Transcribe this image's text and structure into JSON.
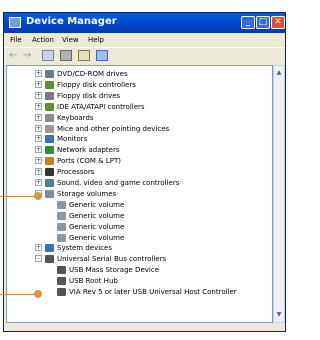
{
  "window": {
    "title": "Device Manager",
    "buttons": {
      "minimize": "_",
      "maximize": "□",
      "close": "✕"
    }
  },
  "menu": [
    "File",
    "Action",
    "View",
    "Help"
  ],
  "toolbar": [
    "back-icon",
    "forward-icon",
    "properties-icon",
    "print-icon",
    "help-icon",
    "scan-icon"
  ],
  "tree": [
    {
      "label": "DVD/CD-ROM drives",
      "icon": "cdrom-icon",
      "color": "#6b7a8a",
      "level": 1,
      "exp": "+"
    },
    {
      "label": "Floppy disk controllers",
      "icon": "controller-icon",
      "color": "#5f8f3a",
      "level": 1,
      "exp": "+"
    },
    {
      "label": "Floppy disk drives",
      "icon": "floppy-icon",
      "color": "#7a7a7a",
      "level": 1,
      "exp": "+"
    },
    {
      "label": "IDE ATA/ATAPI controllers",
      "icon": "ide-icon",
      "color": "#5f8f3a",
      "level": 1,
      "exp": "+"
    },
    {
      "label": "Keyboards",
      "icon": "keyboard-icon",
      "color": "#8a8a8a",
      "level": 1,
      "exp": "+"
    },
    {
      "label": "Mice and other pointing devices",
      "icon": "mouse-icon",
      "color": "#9a9a9a",
      "level": 1,
      "exp": "+"
    },
    {
      "label": "Monitors",
      "icon": "monitor-icon",
      "color": "#3c6fb6",
      "level": 1,
      "exp": "+"
    },
    {
      "label": "Network adapters",
      "icon": "network-icon",
      "color": "#3b8a3b",
      "level": 1,
      "exp": "+"
    },
    {
      "label": "Ports (COM & LPT)",
      "icon": "port-icon",
      "color": "#b48a2a",
      "level": 1,
      "exp": "+"
    },
    {
      "label": "Processors",
      "icon": "processor-icon",
      "color": "#333333",
      "level": 1,
      "exp": "+"
    },
    {
      "label": "Sound, video and game controllers",
      "icon": "sound-icon",
      "color": "#4b7f8f",
      "level": 1,
      "exp": "+"
    },
    {
      "label": "Storage volumes",
      "icon": "storage-icon",
      "color": "#7d8c99",
      "level": 1,
      "exp": "-"
    },
    {
      "label": "Generic volume",
      "icon": "volume-icon",
      "color": "#8a98a6",
      "level": 2,
      "exp": ""
    },
    {
      "label": "Generic volume",
      "icon": "volume-icon",
      "color": "#8a98a6",
      "level": 2,
      "exp": ""
    },
    {
      "label": "Generic volume",
      "icon": "volume-icon",
      "color": "#8a98a6",
      "level": 2,
      "exp": ""
    },
    {
      "label": "Generic volume",
      "icon": "volume-icon",
      "color": "#8a98a6",
      "level": 2,
      "exp": ""
    },
    {
      "label": "System devices",
      "icon": "system-icon",
      "color": "#3c6fb6",
      "level": 1,
      "exp": "+"
    },
    {
      "label": "Universal Serial Bus controllers",
      "icon": "usb-icon",
      "color": "#555555",
      "level": 1,
      "exp": "-"
    },
    {
      "label": "USB Mass Storage Device",
      "icon": "usb-device-icon",
      "color": "#555555",
      "level": 2,
      "exp": ""
    },
    {
      "label": "USB Root Hub",
      "icon": "usb-device-icon",
      "color": "#555555",
      "level": 2,
      "exp": ""
    },
    {
      "label": "VIA Rev 5 or later USB Universal Host Controller",
      "icon": "usb-device-icon",
      "color": "#555555",
      "level": 2,
      "exp": ""
    }
  ],
  "accent": "#d59648"
}
